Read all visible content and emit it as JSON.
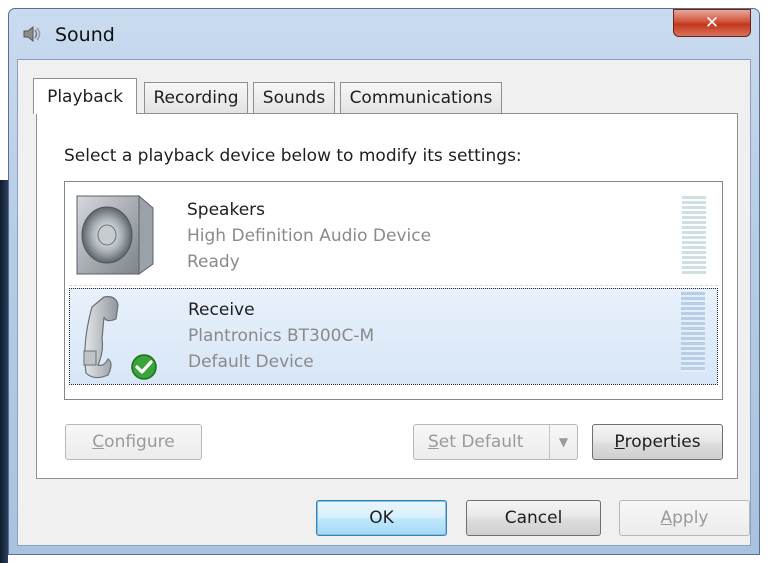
{
  "window": {
    "title": "Sound",
    "close_label": "✕"
  },
  "tabs": [
    {
      "label": "Playback",
      "active": true
    },
    {
      "label": "Recording",
      "active": false
    },
    {
      "label": "Sounds",
      "active": false
    },
    {
      "label": "Communications",
      "active": false
    }
  ],
  "instruction": "Select a playback device below to modify its settings:",
  "devices": [
    {
      "name": "Speakers",
      "description": "High Definition Audio Device",
      "status": "Ready",
      "icon": "speaker-icon",
      "selected": false
    },
    {
      "name": "Receive",
      "description": "Plantronics BT300C-M",
      "status": "Default Device",
      "icon": "handset-icon",
      "selected": true,
      "default_badge": "check-icon"
    }
  ],
  "buttons": {
    "configure": {
      "underline": "C",
      "rest": "onfigure"
    },
    "set_default": {
      "underline": "S",
      "rest": "et Default"
    },
    "properties": {
      "underline": "P",
      "rest": "roperties"
    },
    "ok": "OK",
    "cancel": "Cancel",
    "apply": {
      "underline": "A",
      "rest": "pply"
    }
  },
  "colors": {
    "selection": "#d7e6f7",
    "accent_ok": "#3c7fb1",
    "close_red": "#c2371c",
    "check_green": "#3aa33a"
  }
}
